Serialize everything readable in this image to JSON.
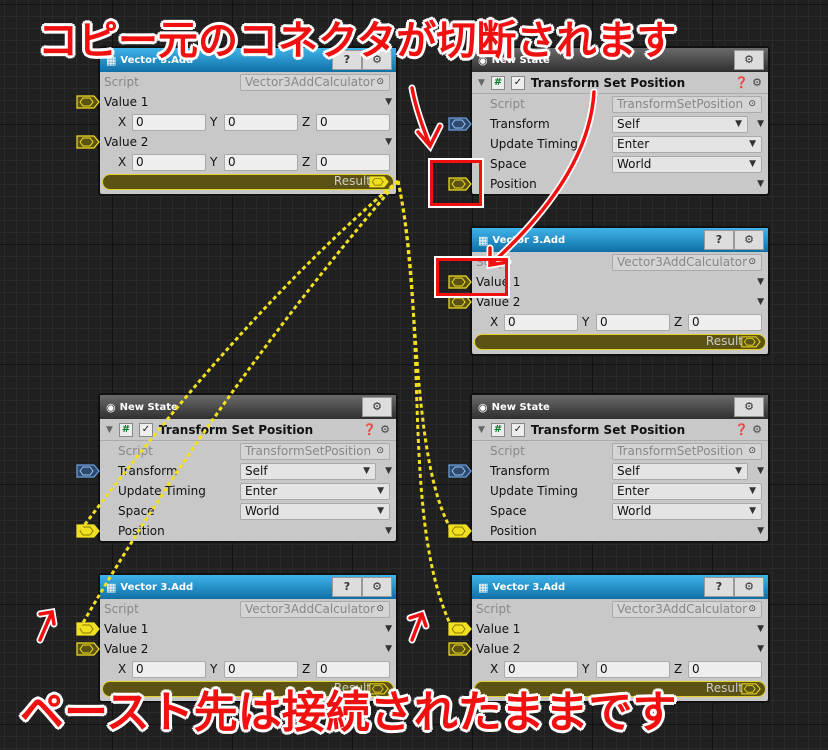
{
  "annotations": {
    "top": "コピー元のコネクタが切断されます",
    "bottom": "ペースト先は接続されたままです"
  },
  "colors": {
    "accent_red": "#f01010",
    "connector_yellow": "#f0e020",
    "transform_port": "#3a6ea8"
  },
  "nodes": [
    {
      "id": "a",
      "kind": "vec",
      "title": "Vector 3.Add",
      "script_label": "Script",
      "script": "Vector3AddCalculator",
      "rows": [
        {
          "label": "Value 1",
          "xyz": [
            "0",
            "0",
            "0"
          ],
          "connected": false
        },
        {
          "label": "Value 2",
          "xyz": [
            "0",
            "0",
            "0"
          ],
          "connected": false
        }
      ],
      "result": "Result",
      "icon": "calculator-icon"
    },
    {
      "id": "b",
      "kind": "state",
      "title": "New State",
      "component": "Transform Set Position",
      "script_label": "Script",
      "script": "TransformSetPosition",
      "fields": [
        {
          "label": "Transform",
          "value": "Self"
        },
        {
          "label": "Update Timing",
          "value": "Enter"
        },
        {
          "label": "Space",
          "value": "World"
        }
      ],
      "position_label": "Position",
      "position_connected": false
    },
    {
      "id": "c",
      "kind": "vec",
      "title": "Vector 3.Add",
      "script_label": "Script",
      "script": "Vector3AddCalculator",
      "rows": [
        {
          "label": "Value 1",
          "connected": false
        },
        {
          "label": "Value 2",
          "xyz": [
            "0",
            "0",
            "0"
          ],
          "connected": false
        }
      ],
      "result": "Result",
      "icon": "calculator-icon"
    },
    {
      "id": "d",
      "kind": "state",
      "title": "New State",
      "component": "Transform Set Position",
      "script_label": "Script",
      "script": "TransformSetPosition",
      "fields": [
        {
          "label": "Transform",
          "value": "Self"
        },
        {
          "label": "Update Timing",
          "value": "Enter"
        },
        {
          "label": "Space",
          "value": "World"
        }
      ],
      "position_label": "Position",
      "position_connected": true
    },
    {
      "id": "e",
      "kind": "state",
      "title": "New State",
      "component": "Transform Set Position",
      "script_label": "Script",
      "script": "TransformSetPosition",
      "fields": [
        {
          "label": "Transform",
          "value": "Self"
        },
        {
          "label": "Update Timing",
          "value": "Enter"
        },
        {
          "label": "Space",
          "value": "World"
        }
      ],
      "position_label": "Position",
      "position_connected": true
    },
    {
      "id": "f",
      "kind": "vec",
      "title": "Vector 3.Add",
      "script_label": "Script",
      "script": "Vector3AddCalculator",
      "rows": [
        {
          "label": "Value 1",
          "connected": true
        },
        {
          "label": "Value 2",
          "xyz": [
            "0",
            "0",
            "0"
          ],
          "connected": false
        }
      ],
      "result": "Result",
      "icon": "calculator-icon"
    },
    {
      "id": "g",
      "kind": "vec",
      "title": "Vector 3.Add",
      "script_label": "Script",
      "script": "Vector3AddCalculator",
      "rows": [
        {
          "label": "Value 1",
          "connected": true
        },
        {
          "label": "Value 2",
          "xyz": [
            "0",
            "0",
            "0"
          ],
          "connected": false
        }
      ],
      "result": "Result",
      "icon": "calculator-icon"
    }
  ]
}
